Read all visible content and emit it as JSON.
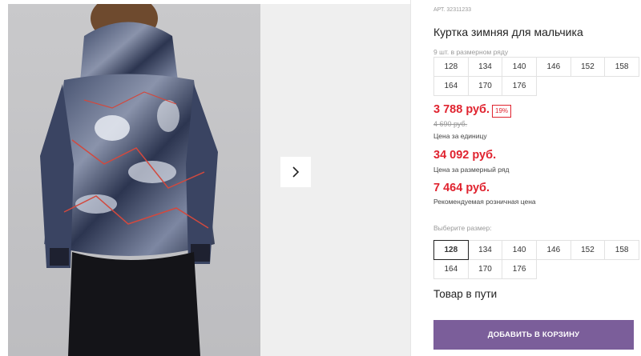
{
  "product": {
    "sku": "АРТ. 32311233",
    "title": "Куртка зимняя для мальчика",
    "pack_label": "9 шт. в размерном ряду",
    "pack_sizes": [
      "128",
      "134",
      "140",
      "146",
      "152",
      "158",
      "164",
      "170",
      "176"
    ],
    "price": "3 788 руб.",
    "discount": "19%",
    "old_price": "4 690 руб.",
    "price_note": "Цена за единицу",
    "pack_price": "34 092 руб.",
    "pack_price_note": "Цена за размерный ряд",
    "retail_price": "7 464 руб.",
    "retail_price_note": "Рекомендуемая розничная цена",
    "choose_label": "Выберите размер:",
    "sizes": [
      "128",
      "134",
      "140",
      "146",
      "152",
      "158",
      "164",
      "170",
      "176"
    ],
    "selected_size": "128",
    "status": "Товар в пути",
    "cart_button": "ДОБАВИТЬ В КОРЗИНУ"
  },
  "gallery": {
    "next_icon": "chevron-right-icon"
  },
  "colors": {
    "price_red": "#e0232f",
    "button_purple": "#7b5e9a",
    "muted_text": "#9a9a9a"
  }
}
